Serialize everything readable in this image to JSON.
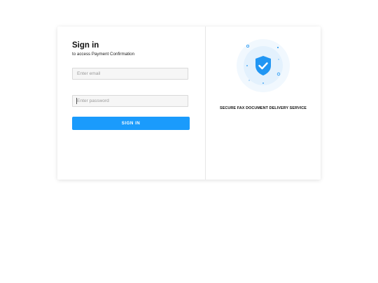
{
  "signin": {
    "title": "Sign in",
    "subtitle": "to access Payment Confirmation",
    "email_placeholder": "Enter email",
    "password_placeholder": "Enter password",
    "button_label": "SIGN IN"
  },
  "promo": {
    "illustration_icon": "shield-check-icon",
    "tagline": "SECURE FAX DOCUMENT DELIVERY SERVICE"
  },
  "colors": {
    "accent": "#1a9bfc",
    "shield": "#2196f3",
    "halo": "#e8f3fd"
  }
}
